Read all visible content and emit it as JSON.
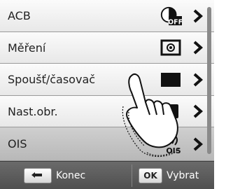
{
  "menu": {
    "items": [
      {
        "label": "ACB",
        "value_icon": "acb-off-icon"
      },
      {
        "label": "Měření",
        "value_icon": "metering-center-icon"
      },
      {
        "label": "Spoušť/časovač",
        "value_icon": "single-shot-icon"
      },
      {
        "label": "Nast.obr.",
        "value_icon": "image-adjust-icon"
      },
      {
        "label": "OIS",
        "value_icon": "ois-icon"
      }
    ],
    "selected_index": 4
  },
  "bottom_bar": {
    "back_label": "Konec",
    "ok_key": "OK",
    "ok_label": "Vybrat"
  },
  "colors": {
    "row_bg": "#f2f2f2",
    "selected_bg": "#c4c4c4",
    "bar_bg": "#5a5a5a",
    "text": "#222222"
  }
}
